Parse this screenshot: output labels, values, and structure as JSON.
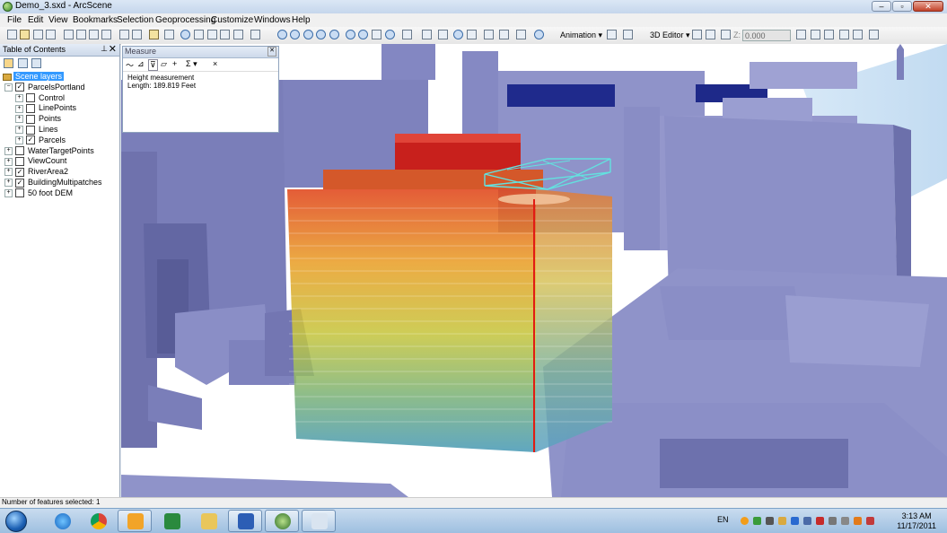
{
  "window": {
    "title": "Demo_3.sxd - ArcScene"
  },
  "menu": [
    "File",
    "Edit",
    "View",
    "Bookmarks",
    "Selection",
    "Geoprocessing",
    "Customize",
    "Windows",
    "Help"
  ],
  "toolbar": {
    "animation_label": "Animation ▾",
    "editor_label": "3D Editor ▾",
    "z_label": "Z:",
    "z_value": "0.000"
  },
  "toc": {
    "title": "Table of Contents",
    "items": [
      {
        "label": "Scene layers",
        "level": 0,
        "selected": true
      },
      {
        "label": "ParcelsPortland",
        "level": 1,
        "expand": "⊟",
        "checked": true
      },
      {
        "label": "Control",
        "level": 2,
        "expand": "⊞",
        "checked": false
      },
      {
        "label": "LinePoints",
        "level": 2,
        "expand": "⊞",
        "checked": false
      },
      {
        "label": "Points",
        "level": 2,
        "expand": "⊞",
        "checked": false
      },
      {
        "label": "Lines",
        "level": 2,
        "expand": "⊞",
        "checked": false
      },
      {
        "label": "Parcels",
        "level": 2,
        "expand": "⊞",
        "checked": true
      },
      {
        "label": "WaterTargetPoints",
        "level": 1,
        "expand": "⊞",
        "checked": false
      },
      {
        "label": "ViewCount",
        "level": 1,
        "expand": "⊞",
        "checked": false
      },
      {
        "label": "RiverArea2",
        "level": 1,
        "expand": "⊞",
        "checked": true
      },
      {
        "label": "BuildingMultipatches",
        "level": 1,
        "expand": "⊞",
        "checked": true
      },
      {
        "label": "50 foot DEM",
        "level": 1,
        "expand": "⊞",
        "checked": false
      }
    ]
  },
  "measure": {
    "title": "Measure",
    "mode": "Height measurement",
    "result": "Length: 189.819 Feet",
    "sigma": "Σ ▾",
    "close": "×"
  },
  "status": {
    "text": "Number of features selected: 1"
  },
  "taskbar": {
    "lang": "EN",
    "time": "3:13 AM",
    "date": "11/17/2011"
  },
  "colors": {
    "building_base": "#8f93c9",
    "ground": "#ffffff",
    "water": "#c9e0f6",
    "highlight_top": "#d22a1e",
    "highlight_bottom": "#4aa0bd",
    "selection_outline": "#63e1df"
  }
}
